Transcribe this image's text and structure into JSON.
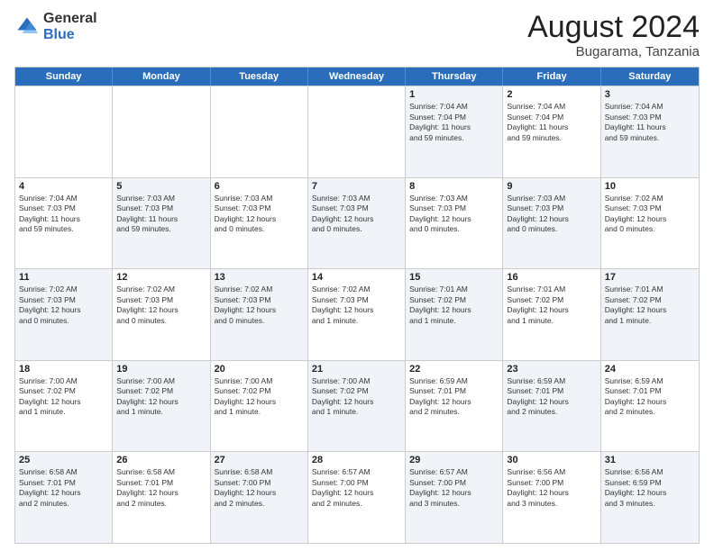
{
  "logo": {
    "general": "General",
    "blue": "Blue"
  },
  "title": "August 2024",
  "location": "Bugarama, Tanzania",
  "header_days": [
    "Sunday",
    "Monday",
    "Tuesday",
    "Wednesday",
    "Thursday",
    "Friday",
    "Saturday"
  ],
  "rows": [
    [
      {
        "day": "",
        "text": "",
        "shaded": false,
        "empty": true
      },
      {
        "day": "",
        "text": "",
        "shaded": false,
        "empty": true
      },
      {
        "day": "",
        "text": "",
        "shaded": false,
        "empty": true
      },
      {
        "day": "",
        "text": "",
        "shaded": false,
        "empty": true
      },
      {
        "day": "1",
        "text": "Sunrise: 7:04 AM\nSunset: 7:04 PM\nDaylight: 11 hours\nand 59 minutes.",
        "shaded": true,
        "empty": false
      },
      {
        "day": "2",
        "text": "Sunrise: 7:04 AM\nSunset: 7:04 PM\nDaylight: 11 hours\nand 59 minutes.",
        "shaded": false,
        "empty": false
      },
      {
        "day": "3",
        "text": "Sunrise: 7:04 AM\nSunset: 7:03 PM\nDaylight: 11 hours\nand 59 minutes.",
        "shaded": true,
        "empty": false
      }
    ],
    [
      {
        "day": "4",
        "text": "Sunrise: 7:04 AM\nSunset: 7:03 PM\nDaylight: 11 hours\nand 59 minutes.",
        "shaded": false,
        "empty": false
      },
      {
        "day": "5",
        "text": "Sunrise: 7:03 AM\nSunset: 7:03 PM\nDaylight: 11 hours\nand 59 minutes.",
        "shaded": true,
        "empty": false
      },
      {
        "day": "6",
        "text": "Sunrise: 7:03 AM\nSunset: 7:03 PM\nDaylight: 12 hours\nand 0 minutes.",
        "shaded": false,
        "empty": false
      },
      {
        "day": "7",
        "text": "Sunrise: 7:03 AM\nSunset: 7:03 PM\nDaylight: 12 hours\nand 0 minutes.",
        "shaded": true,
        "empty": false
      },
      {
        "day": "8",
        "text": "Sunrise: 7:03 AM\nSunset: 7:03 PM\nDaylight: 12 hours\nand 0 minutes.",
        "shaded": false,
        "empty": false
      },
      {
        "day": "9",
        "text": "Sunrise: 7:03 AM\nSunset: 7:03 PM\nDaylight: 12 hours\nand 0 minutes.",
        "shaded": true,
        "empty": false
      },
      {
        "day": "10",
        "text": "Sunrise: 7:02 AM\nSunset: 7:03 PM\nDaylight: 12 hours\nand 0 minutes.",
        "shaded": false,
        "empty": false
      }
    ],
    [
      {
        "day": "11",
        "text": "Sunrise: 7:02 AM\nSunset: 7:03 PM\nDaylight: 12 hours\nand 0 minutes.",
        "shaded": true,
        "empty": false
      },
      {
        "day": "12",
        "text": "Sunrise: 7:02 AM\nSunset: 7:03 PM\nDaylight: 12 hours\nand 0 minutes.",
        "shaded": false,
        "empty": false
      },
      {
        "day": "13",
        "text": "Sunrise: 7:02 AM\nSunset: 7:03 PM\nDaylight: 12 hours\nand 0 minutes.",
        "shaded": true,
        "empty": false
      },
      {
        "day": "14",
        "text": "Sunrise: 7:02 AM\nSunset: 7:03 PM\nDaylight: 12 hours\nand 1 minute.",
        "shaded": false,
        "empty": false
      },
      {
        "day": "15",
        "text": "Sunrise: 7:01 AM\nSunset: 7:02 PM\nDaylight: 12 hours\nand 1 minute.",
        "shaded": true,
        "empty": false
      },
      {
        "day": "16",
        "text": "Sunrise: 7:01 AM\nSunset: 7:02 PM\nDaylight: 12 hours\nand 1 minute.",
        "shaded": false,
        "empty": false
      },
      {
        "day": "17",
        "text": "Sunrise: 7:01 AM\nSunset: 7:02 PM\nDaylight: 12 hours\nand 1 minute.",
        "shaded": true,
        "empty": false
      }
    ],
    [
      {
        "day": "18",
        "text": "Sunrise: 7:00 AM\nSunset: 7:02 PM\nDaylight: 12 hours\nand 1 minute.",
        "shaded": false,
        "empty": false
      },
      {
        "day": "19",
        "text": "Sunrise: 7:00 AM\nSunset: 7:02 PM\nDaylight: 12 hours\nand 1 minute.",
        "shaded": true,
        "empty": false
      },
      {
        "day": "20",
        "text": "Sunrise: 7:00 AM\nSunset: 7:02 PM\nDaylight: 12 hours\nand 1 minute.",
        "shaded": false,
        "empty": false
      },
      {
        "day": "21",
        "text": "Sunrise: 7:00 AM\nSunset: 7:02 PM\nDaylight: 12 hours\nand 1 minute.",
        "shaded": true,
        "empty": false
      },
      {
        "day": "22",
        "text": "Sunrise: 6:59 AM\nSunset: 7:01 PM\nDaylight: 12 hours\nand 2 minutes.",
        "shaded": false,
        "empty": false
      },
      {
        "day": "23",
        "text": "Sunrise: 6:59 AM\nSunset: 7:01 PM\nDaylight: 12 hours\nand 2 minutes.",
        "shaded": true,
        "empty": false
      },
      {
        "day": "24",
        "text": "Sunrise: 6:59 AM\nSunset: 7:01 PM\nDaylight: 12 hours\nand 2 minutes.",
        "shaded": false,
        "empty": false
      }
    ],
    [
      {
        "day": "25",
        "text": "Sunrise: 6:58 AM\nSunset: 7:01 PM\nDaylight: 12 hours\nand 2 minutes.",
        "shaded": true,
        "empty": false
      },
      {
        "day": "26",
        "text": "Sunrise: 6:58 AM\nSunset: 7:01 PM\nDaylight: 12 hours\nand 2 minutes.",
        "shaded": false,
        "empty": false
      },
      {
        "day": "27",
        "text": "Sunrise: 6:58 AM\nSunset: 7:00 PM\nDaylight: 12 hours\nand 2 minutes.",
        "shaded": true,
        "empty": false
      },
      {
        "day": "28",
        "text": "Sunrise: 6:57 AM\nSunset: 7:00 PM\nDaylight: 12 hours\nand 2 minutes.",
        "shaded": false,
        "empty": false
      },
      {
        "day": "29",
        "text": "Sunrise: 6:57 AM\nSunset: 7:00 PM\nDaylight: 12 hours\nand 3 minutes.",
        "shaded": true,
        "empty": false
      },
      {
        "day": "30",
        "text": "Sunrise: 6:56 AM\nSunset: 7:00 PM\nDaylight: 12 hours\nand 3 minutes.",
        "shaded": false,
        "empty": false
      },
      {
        "day": "31",
        "text": "Sunrise: 6:56 AM\nSunset: 6:59 PM\nDaylight: 12 hours\nand 3 minutes.",
        "shaded": true,
        "empty": false
      }
    ]
  ]
}
